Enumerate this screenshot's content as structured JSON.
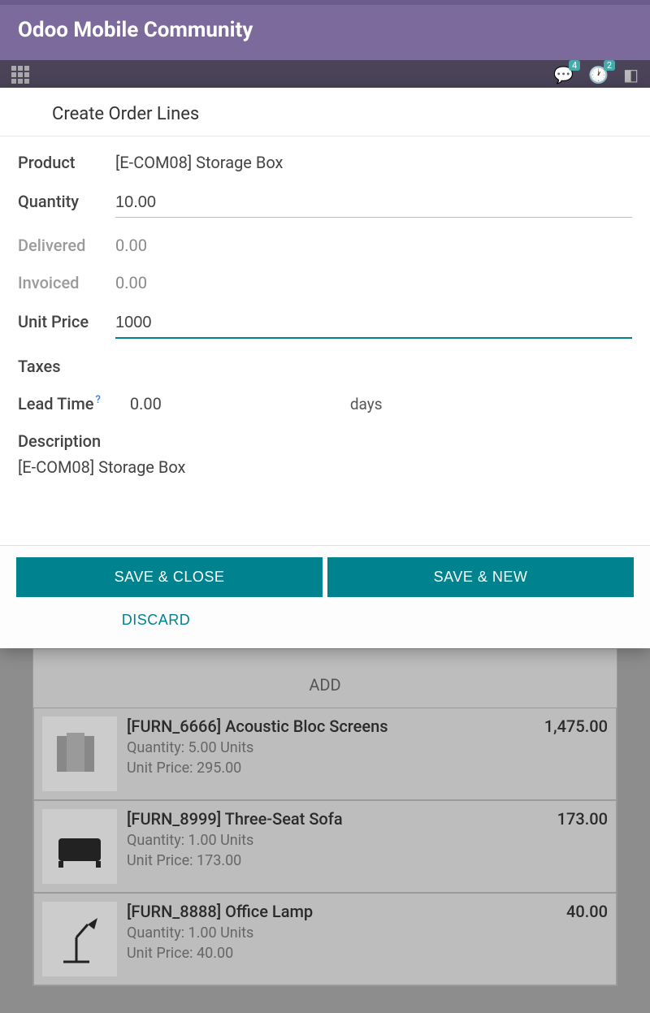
{
  "header": {
    "title": "Odoo Mobile Community",
    "badge1": "4",
    "badge2": "2"
  },
  "dialog": {
    "title": "Create Order Lines",
    "labels": {
      "product": "Product",
      "quantity": "Quantity",
      "delivered": "Delivered",
      "invoiced": "Invoiced",
      "unit_price": "Unit Price",
      "taxes": "Taxes",
      "lead_time": "Lead Time",
      "lead_time_help": "?",
      "lead_time_unit": "days",
      "description": "Description"
    },
    "values": {
      "product": "[E-COM08] Storage Box",
      "quantity": "10.00",
      "delivered": "0.00",
      "invoiced": "0.00",
      "unit_price": "1000",
      "lead_time": "0.00",
      "description": "[E-COM08] Storage Box"
    },
    "buttons": {
      "save_close": "SAVE & CLOSE",
      "save_new": "SAVE & NEW",
      "discard": "DISCARD"
    }
  },
  "background": {
    "add_label": "ADD",
    "quantity_prefix": "Quantity: ",
    "unit_price_prefix": "Unit Price: ",
    "units_suffix": " Units",
    "items": [
      {
        "name": "[FURN_6666] Acoustic Bloc Screens",
        "qty": "5.00",
        "price": "295.00",
        "total": "1,475.00"
      },
      {
        "name": "[FURN_8999] Three-Seat Sofa",
        "qty": "1.00",
        "price": "173.00",
        "total": "173.00"
      },
      {
        "name": "[FURN_8888] Office Lamp",
        "qty": "1.00",
        "price": "40.00",
        "total": "40.00"
      }
    ]
  }
}
